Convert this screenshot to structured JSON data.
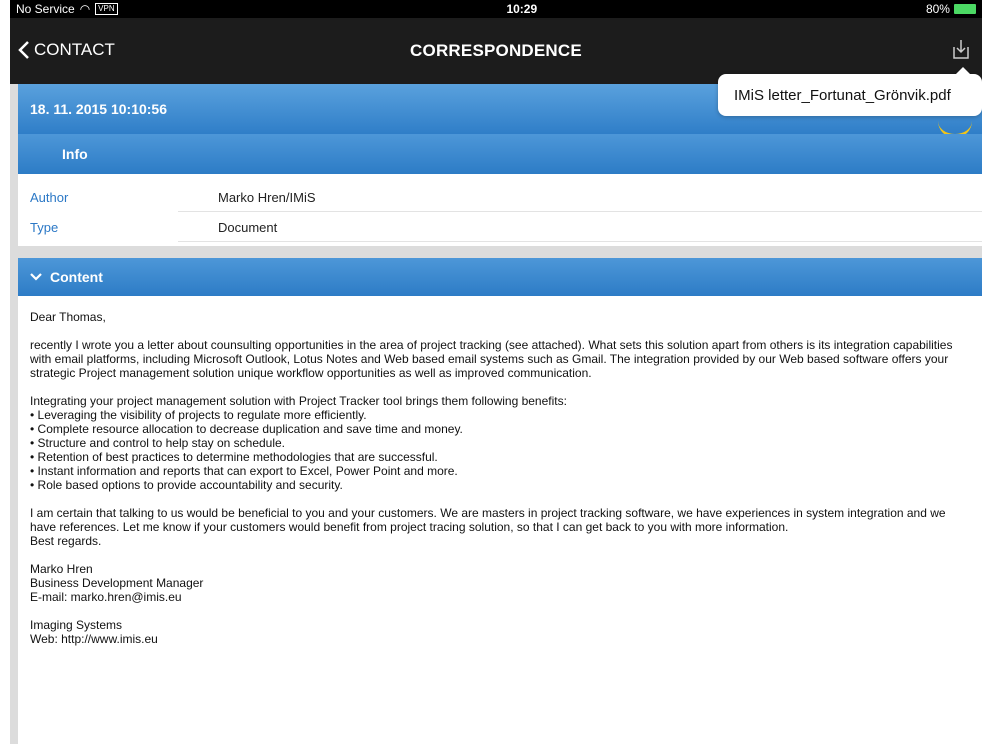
{
  "status": {
    "carrier": "No Service",
    "vpn": "VPN",
    "time": "10:29",
    "battery": "80%"
  },
  "nav": {
    "back_label": "CONTACT",
    "title": "CORRESPONDENCE"
  },
  "tooltip": {
    "filename": "IMiS letter_Fortunat_Grönvik.pdf"
  },
  "date_header": "18. 11. 2015 10:10:56",
  "info": {
    "header": "Info",
    "rows": [
      {
        "key": "Author",
        "value": "Marko Hren/IMiS"
      },
      {
        "key": "Type",
        "value": "Document"
      }
    ]
  },
  "content": {
    "header": "Content",
    "greeting": "Dear Thomas,",
    "para1": "recently I wrote you a letter about counsulting opportunities in the area of project tracking (see attached). What sets this solution apart from others is its integration capabilities with email platforms, including Microsoft Outlook, Lotus Notes and Web based email systems such as Gmail. The integration provided by our Web based software offers your strategic Project management solution unique workflow opportunities as well as improved communication.",
    "list_intro": "Integrating your project management solution with Project Tracker tool brings them following benefits:",
    "bullets": [
      "• Leveraging the visibility of projects to regulate more efficiently.",
      "• Complete resource allocation to decrease duplication and save time and money.",
      "• Structure and control to help stay on schedule.",
      "• Retention of best practices to determine methodologies that are successful.",
      "• Instant information and reports that can export to Excel, Power Point and more.",
      "• Role based options to provide accountability and security."
    ],
    "para2": "I am certain that talking to us would be beneficial to you and your customers. We are masters in project tracking software, we have experiences in system integration and we have references. Let me know if your customers would benefit from project tracing solution, so that I can get back to you with more information.",
    "closing": "Best regards.",
    "sig_name": "Marko Hren",
    "sig_title": "Business Development Manager",
    "sig_email": "E-mail: marko.hren@imis.eu",
    "sig_company": "Imaging Systems",
    "sig_web": "Web: http://www.imis.eu"
  }
}
